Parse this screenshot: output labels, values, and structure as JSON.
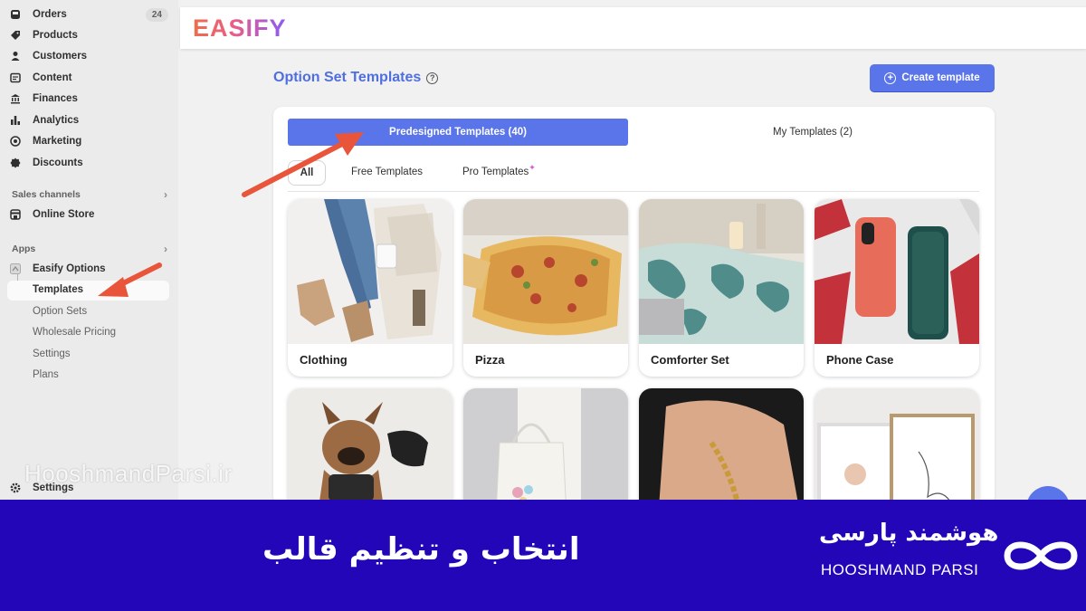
{
  "sidebar": {
    "items": [
      {
        "label": "Orders",
        "badge": "24",
        "icon": "inbox-icon"
      },
      {
        "label": "Products",
        "icon": "tag-icon"
      },
      {
        "label": "Customers",
        "icon": "person-icon"
      },
      {
        "label": "Content",
        "icon": "content-icon"
      },
      {
        "label": "Finances",
        "icon": "bank-icon"
      },
      {
        "label": "Analytics",
        "icon": "bar-chart-icon"
      },
      {
        "label": "Marketing",
        "icon": "target-icon"
      },
      {
        "label": "Discounts",
        "icon": "discount-icon"
      }
    ],
    "sales_channels": {
      "heading": "Sales channels",
      "items": [
        {
          "label": "Online Store",
          "icon": "store-icon"
        }
      ]
    },
    "apps": {
      "heading": "Apps",
      "app": {
        "label": "Easify Options",
        "icon": "app-icon"
      },
      "sub_items": [
        {
          "label": "Templates",
          "active": true
        },
        {
          "label": "Option Sets"
        },
        {
          "label": "Wholesale Pricing"
        },
        {
          "label": "Settings"
        },
        {
          "label": "Plans"
        }
      ]
    },
    "settings_label": "Settings"
  },
  "app_header": {
    "logo_text": "EASIFY"
  },
  "page": {
    "title": "Option Set Templates",
    "create_button": "Create template",
    "tabs": {
      "predesigned": "Predesigned Templates (40)",
      "mine": "My Templates (2)"
    },
    "filters": {
      "all": "All",
      "free": "Free Templates",
      "pro": "Pro Templates"
    },
    "templates": [
      {
        "label": "Clothing"
      },
      {
        "label": "Pizza"
      },
      {
        "label": "Comforter Set"
      },
      {
        "label": "Phone Case"
      }
    ]
  },
  "watermark": "HooshmandParsi.ir",
  "banner": {
    "title": "انتخاب و تنظیم قالب",
    "brand_fa": "هوشمند پارسی",
    "brand_en": "HOOSHMAND PARSI",
    "color": "#2206b8"
  },
  "colors": {
    "accent": "#5a74ea",
    "arrow": "#e8553a"
  }
}
